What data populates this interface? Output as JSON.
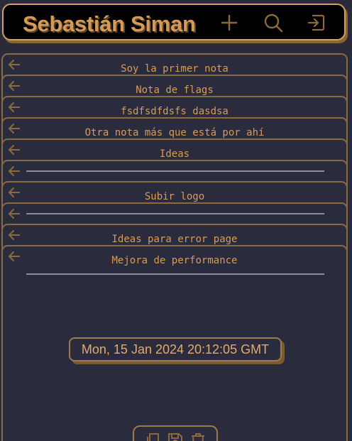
{
  "header": {
    "title": "Sebastián Siman",
    "add_icon": "plus-icon",
    "search_icon": "search-icon",
    "logout_icon": "logout-icon",
    "accent": "#d49a5c"
  },
  "notes": [
    {
      "title": "Soy la primer nota",
      "type": "note"
    },
    {
      "title": "Nota de flags",
      "type": "note"
    },
    {
      "title": "fsdfsdfdsfs dasdsa",
      "type": "note"
    },
    {
      "title": "Otra nota más que está por ahí",
      "type": "note"
    },
    {
      "title": "Ideas",
      "type": "note"
    },
    {
      "title": "",
      "type": "untitled"
    },
    {
      "title": "Subir logo",
      "type": "note"
    },
    {
      "title": "",
      "type": "untitled"
    },
    {
      "title": "Ideas para error page",
      "type": "note"
    },
    {
      "title": "Mejora de performance",
      "type": "expanded"
    }
  ],
  "expanded_note": {
    "title": "Mejora de performance",
    "date": "Mon, 15 Jan 2024 20:12:05 GMT",
    "tools": [
      "copy-icon",
      "save-icon",
      "delete-icon"
    ]
  },
  "colors": {
    "background": "#2a2c3e",
    "card_border": "#8a6a3e",
    "text_accent": "#d89a58"
  }
}
